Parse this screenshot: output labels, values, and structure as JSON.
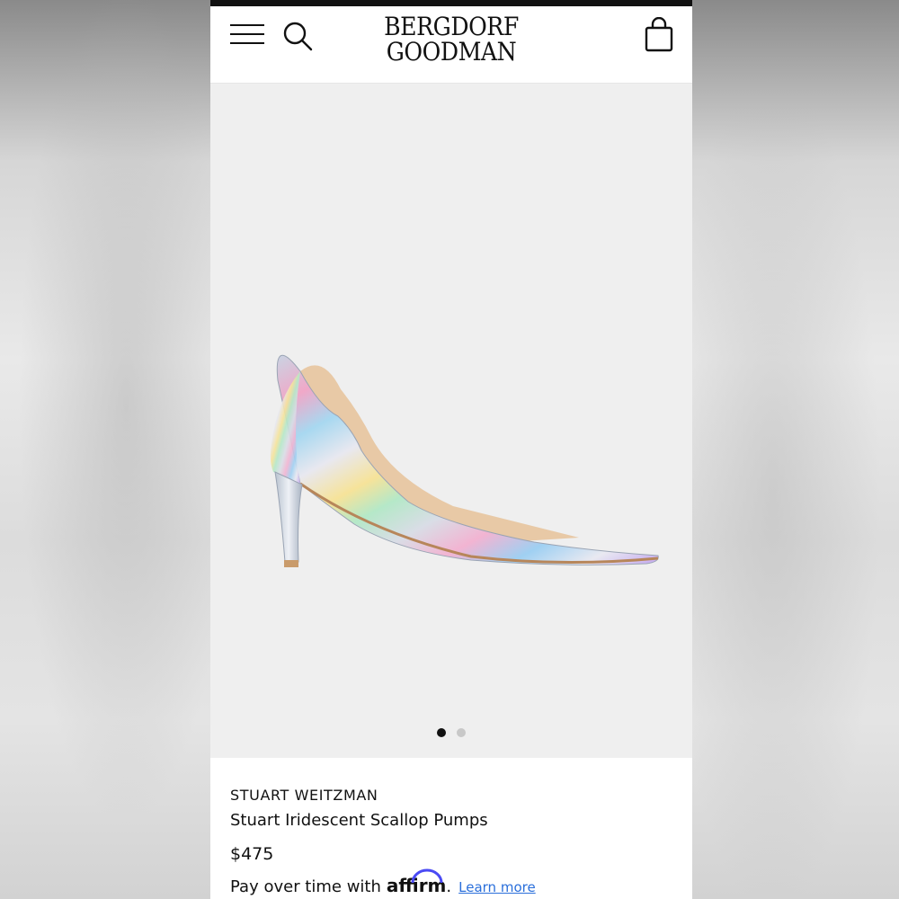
{
  "header": {
    "logo_line1": "BERGDORF",
    "logo_line2": "GOODMAN"
  },
  "icons": {
    "menu": "hamburger-menu-icon",
    "search": "search-icon",
    "bag": "shopping-bag-icon"
  },
  "gallery": {
    "image": "iridescent silver pointed-toe stiletto pump with scalloped topline",
    "pages": 2,
    "current_page": 1
  },
  "product": {
    "brand": "STUART WEITZMAN",
    "name": "Stuart Iridescent Scallop Pumps",
    "price": "$475",
    "pay_text": "Pay over time with",
    "affirm_logo": "affirm",
    "affirm_punct": ".",
    "learn_more": "Learn more"
  },
  "colors": {
    "link": "#2a6fdb",
    "affirm_arc": "#4a4af4",
    "gallery_bg": "#efefef"
  }
}
